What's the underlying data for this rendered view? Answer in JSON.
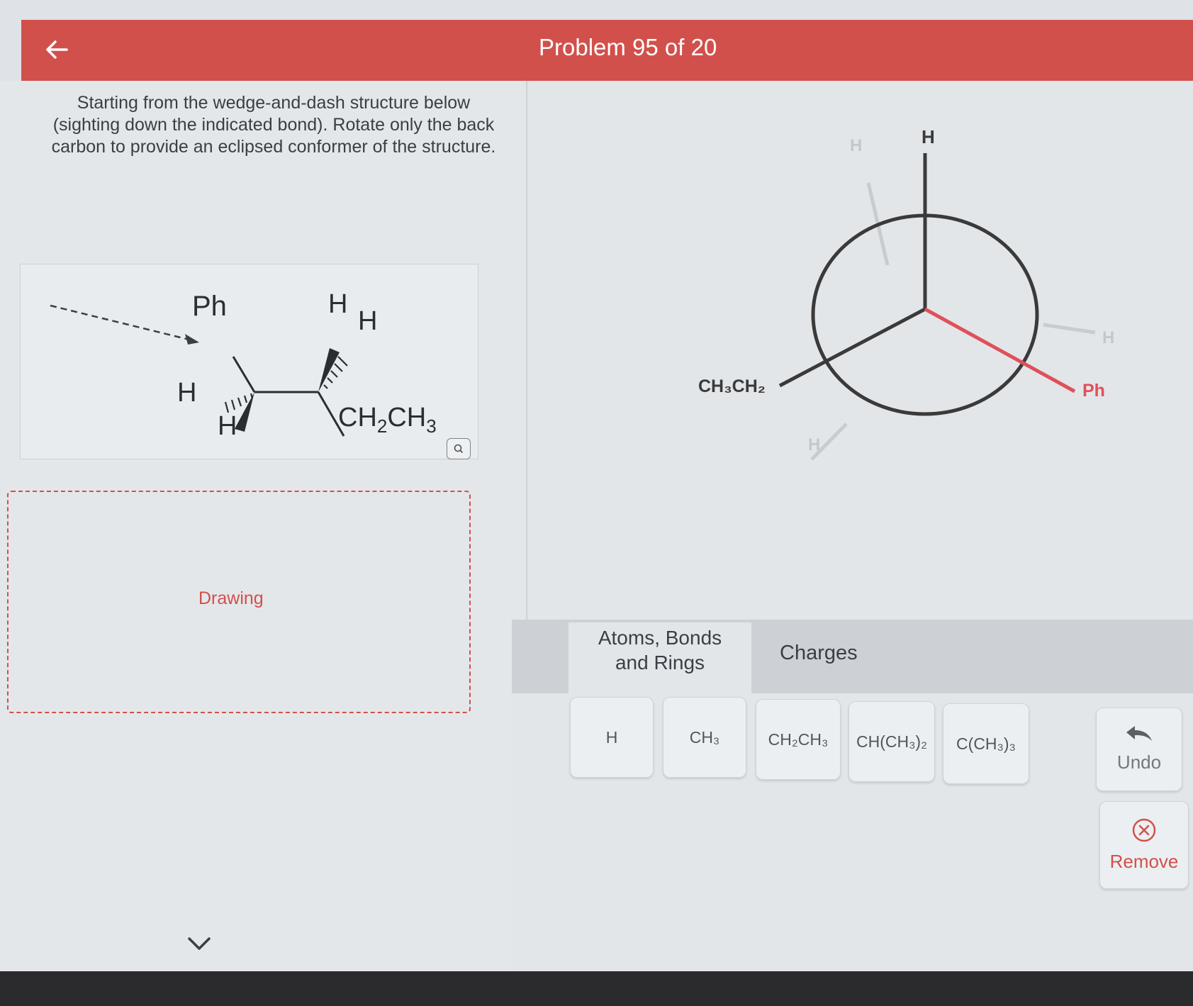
{
  "header": {
    "title": "Problem 95 of 20",
    "back_icon": "arrow-left-icon",
    "color": "#d2504b"
  },
  "question": {
    "text": "Starting from the wedge-and-dash structure below (sighting down the indicated bond). Rotate only the back carbon to provide an eclipsed conformer of the structure."
  },
  "structure": {
    "labels": {
      "ph": "Ph",
      "h_dash_left": "H",
      "h_wedge_left": "H",
      "h_wedge_right": "H",
      "h_dash_right": "H",
      "ethyl_main": "CH",
      "ethyl_sub": "2",
      "ethyl_main2": "CH",
      "ethyl_sub2": "3"
    },
    "zoom_icon": "magnifier-icon"
  },
  "drawing": {
    "label": "Drawing"
  },
  "newman": {
    "front_labels": {
      "top": "H",
      "left": "CH₃CH₂",
      "right": "Ph"
    },
    "back_labels": {
      "upper_left": "H",
      "right": "H",
      "bottom": "H"
    },
    "highlight_color": "#e0505a"
  },
  "tabs": {
    "atoms_line1": "Atoms, Bonds",
    "atoms_line2": "and Rings",
    "charges": "Charges"
  },
  "tools": [
    {
      "label": "H"
    },
    {
      "label": "CH₃"
    },
    {
      "label": "CH₂CH₃"
    },
    {
      "label": "CH(CH₃)₂"
    },
    {
      "label": "C(CH₃)₃"
    }
  ],
  "actions": {
    "undo": "Undo",
    "undo_icon": "undo-arrow-icon",
    "remove": "Remove",
    "remove_icon": "circle-x-icon"
  },
  "footer": {
    "chevron_icon": "chevron-down-icon"
  }
}
